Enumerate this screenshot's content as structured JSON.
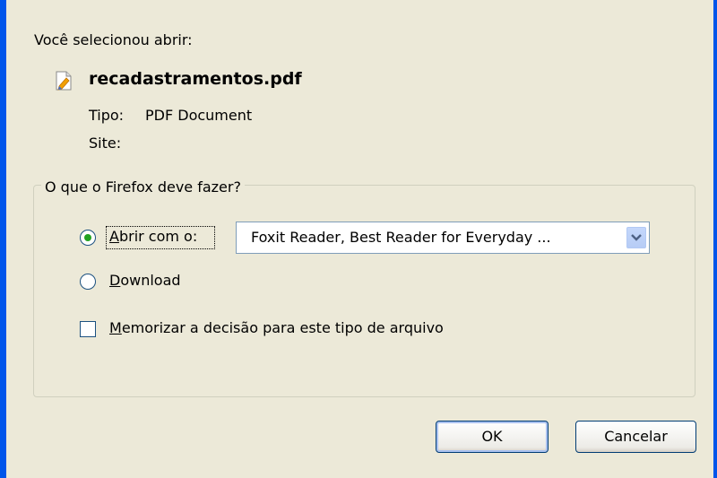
{
  "dialog": {
    "intro": "Você selecionou abrir:",
    "filename": "recadastramentos.pdf",
    "type_label": "Tipo:",
    "type_value": "PDF Document",
    "site_label": "Site:"
  },
  "action_group": {
    "legend": "O que o Firefox deve fazer?",
    "open_with_label": "Abrir com o:",
    "open_with_app": "Foxit Reader, Best Reader for Everyday ...",
    "download_label": "Download",
    "remember_label": "Memorizar a decisão para este tipo de arquivo",
    "selected_option": "open_with",
    "remember_checked": false
  },
  "buttons": {
    "ok": "OK",
    "cancel": "Cancelar"
  },
  "icons": {
    "file": "pdf-file-icon",
    "dropdown": "chevron-down-icon"
  },
  "colors": {
    "window_border": "#0055ea",
    "dialog_bg": "#ece9d8",
    "radio_selected": "#21a121"
  }
}
